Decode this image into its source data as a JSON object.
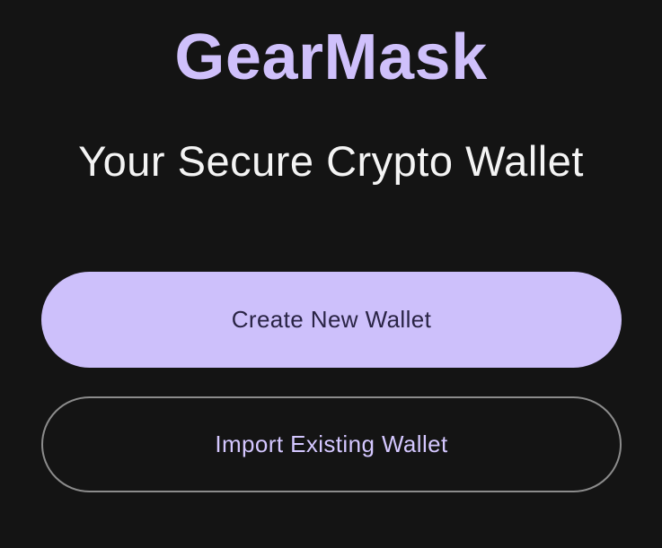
{
  "app": {
    "brand_name": "GearMask",
    "tagline": "Your Secure Crypto Wallet"
  },
  "actions": {
    "create_label": "Create New Wallet",
    "import_label": "Import Existing Wallet"
  },
  "colors": {
    "background": "#141414",
    "brand": "#cfc0fb",
    "primary_button": "#cdc0fb",
    "primary_button_text": "#2a2445",
    "secondary_button_border": "#8c8c8c",
    "secondary_button_text": "#d4c7ff",
    "tagline": "#f4f4f4"
  }
}
